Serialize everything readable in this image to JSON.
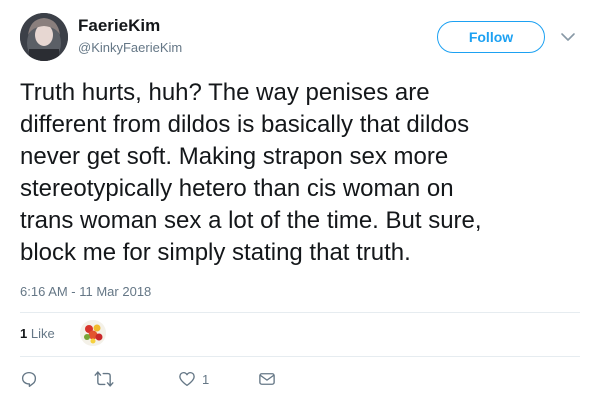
{
  "user": {
    "display_name": "FaerieKim",
    "handle": "@KinkyFaerieKim"
  },
  "follow_button": {
    "label": "Follow"
  },
  "tweet": {
    "text": "Truth hurts, huh? The way penises are\ndifferent from dildos is basically that dildos\nnever get soft. Making strapon sex more\nstereotypically hetero than cis woman on\ntrans woman sex a lot of the time. But sure,\nblock me for simply stating that truth.",
    "timestamp": "6:16 AM - 11 Mar 2018"
  },
  "likes_summary": {
    "count": "1",
    "label": "Like"
  },
  "actions": {
    "reply": {
      "icon": "reply-icon",
      "count": ""
    },
    "retweet": {
      "icon": "retweet-icon",
      "count": ""
    },
    "like": {
      "icon": "heart-icon",
      "count": "1"
    },
    "message": {
      "icon": "envelope-icon",
      "count": ""
    }
  },
  "colors": {
    "accent": "#1da1f2",
    "text": "#14171a",
    "muted": "#657786",
    "divider": "#e6ecf0"
  }
}
